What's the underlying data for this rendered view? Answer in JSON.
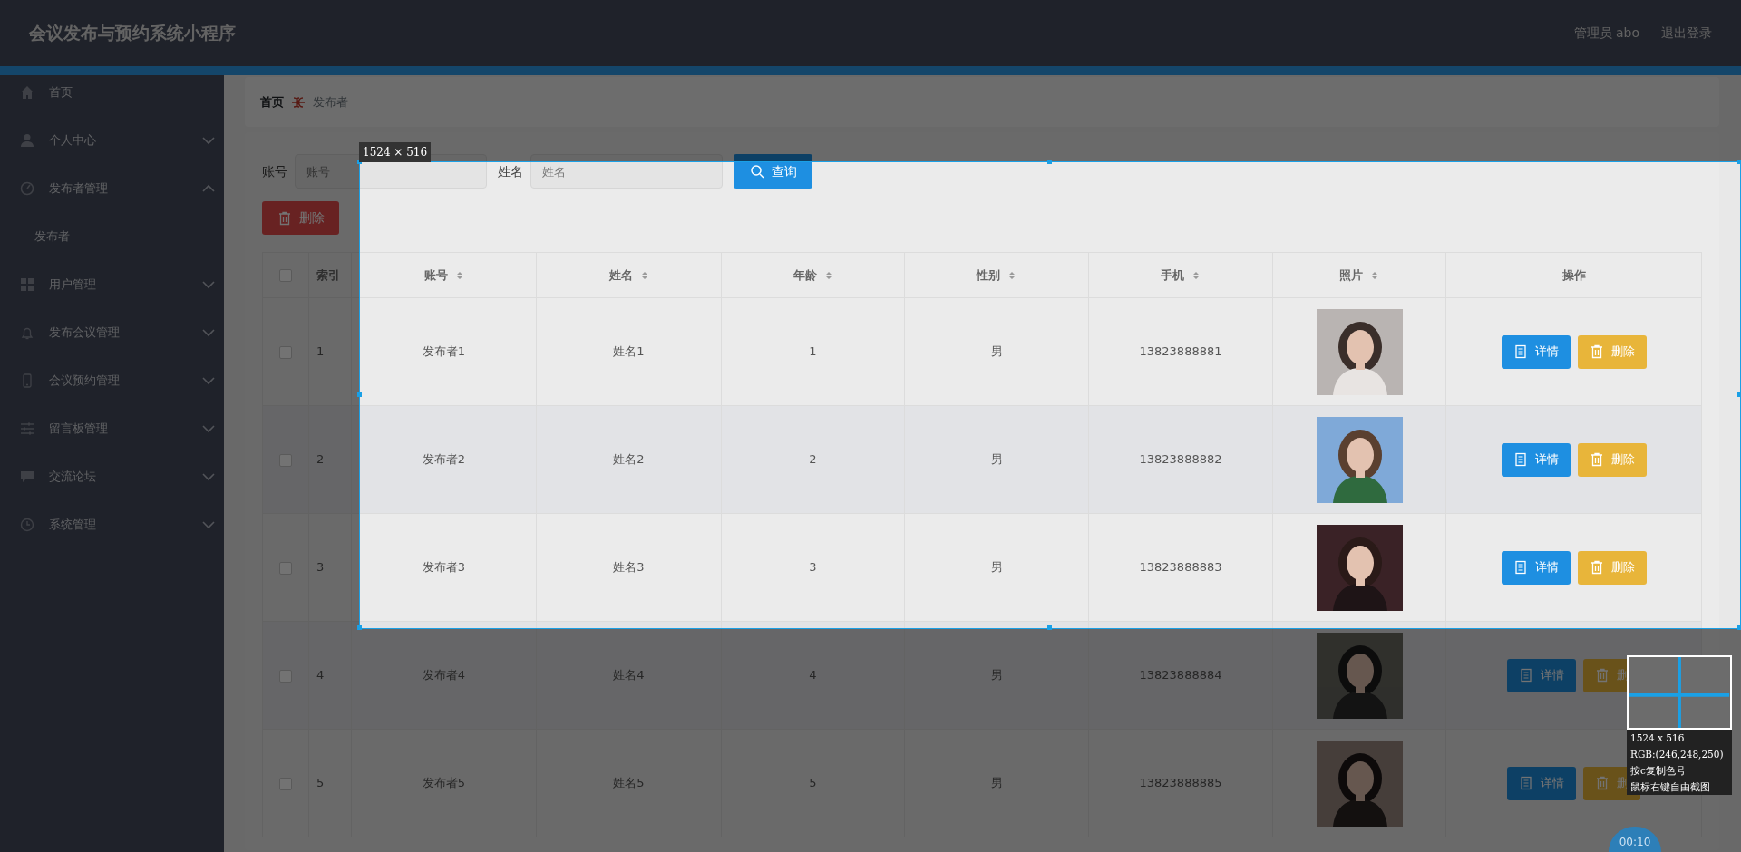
{
  "header": {
    "title": "会议发布与预约系统小程序",
    "user": "管理员 abo",
    "logout": "退出登录"
  },
  "sidebar": {
    "items": [
      {
        "label": "首页"
      },
      {
        "label": "个人中心",
        "expanded": false
      },
      {
        "label": "发布者管理",
        "expanded": true,
        "children": [
          {
            "label": "发布者"
          }
        ]
      },
      {
        "label": "用户管理",
        "expanded": false
      },
      {
        "label": "发布会议管理",
        "expanded": false
      },
      {
        "label": "会议预约管理",
        "expanded": false
      },
      {
        "label": "留言板管理",
        "expanded": false
      },
      {
        "label": "交流论坛",
        "expanded": false
      },
      {
        "label": "系统管理",
        "expanded": false
      }
    ]
  },
  "breadcrumb": [
    "首页",
    "发布者"
  ],
  "search": {
    "fields": [
      {
        "label": "账号",
        "placeholder": "账号"
      },
      {
        "label": "姓名",
        "placeholder": "姓名"
      }
    ],
    "button": "查询"
  },
  "delete_button": "删除",
  "table": {
    "all_checked": false,
    "columns": [
      {
        "label": "索引",
        "sortable": false
      },
      {
        "label": "账号",
        "sortable": true
      },
      {
        "label": "姓名",
        "sortable": true
      },
      {
        "label": "年龄",
        "sortable": true
      },
      {
        "label": "性别",
        "sortable": true
      },
      {
        "label": "手机",
        "sortable": true
      },
      {
        "label": "照片",
        "sortable": true
      },
      {
        "label": "操作",
        "sortable": false
      }
    ],
    "rows": [
      {
        "checked": false,
        "index": "1",
        "account": "发布者1",
        "name": "姓名1",
        "age": "1",
        "gender": "男",
        "phone": "13823888881",
        "actions": [
          {
            "label": "详情",
            "kind": "detail"
          },
          {
            "label": "删除",
            "kind": "delete"
          }
        ]
      },
      {
        "checked": false,
        "index": "2",
        "account": "发布者2",
        "name": "姓名2",
        "age": "2",
        "gender": "男",
        "phone": "13823888882",
        "actions": [
          {
            "label": "详情",
            "kind": "detail"
          },
          {
            "label": "删除",
            "kind": "delete"
          }
        ]
      },
      {
        "checked": false,
        "index": "3",
        "account": "发布者3",
        "name": "姓名3",
        "age": "3",
        "gender": "男",
        "phone": "13823888883",
        "actions": [
          {
            "label": "详情",
            "kind": "detail"
          },
          {
            "label": "删除",
            "kind": "delete"
          }
        ]
      },
      {
        "checked": false,
        "index": "4",
        "account": "发布者4",
        "name": "姓名4",
        "age": "4",
        "gender": "男",
        "phone": "13823888884",
        "actions": [
          {
            "label": "详情",
            "kind": "detail"
          },
          {
            "label": "删",
            "kind": "delete"
          }
        ]
      },
      {
        "checked": false,
        "index": "5",
        "account": "发布者5",
        "name": "姓名5",
        "age": "5",
        "gender": "男",
        "phone": "13823888885",
        "actions": [
          {
            "label": "详情",
            "kind": "detail"
          },
          {
            "label": "删",
            "kind": "delete"
          }
        ]
      }
    ]
  },
  "capture_tool": {
    "size_label": "1524 × 516",
    "info": [
      "1524 x 516",
      "RGB:(246,248,250)",
      "按c复制色号",
      "鼠标右键自由截图"
    ],
    "timer": "00:10"
  }
}
